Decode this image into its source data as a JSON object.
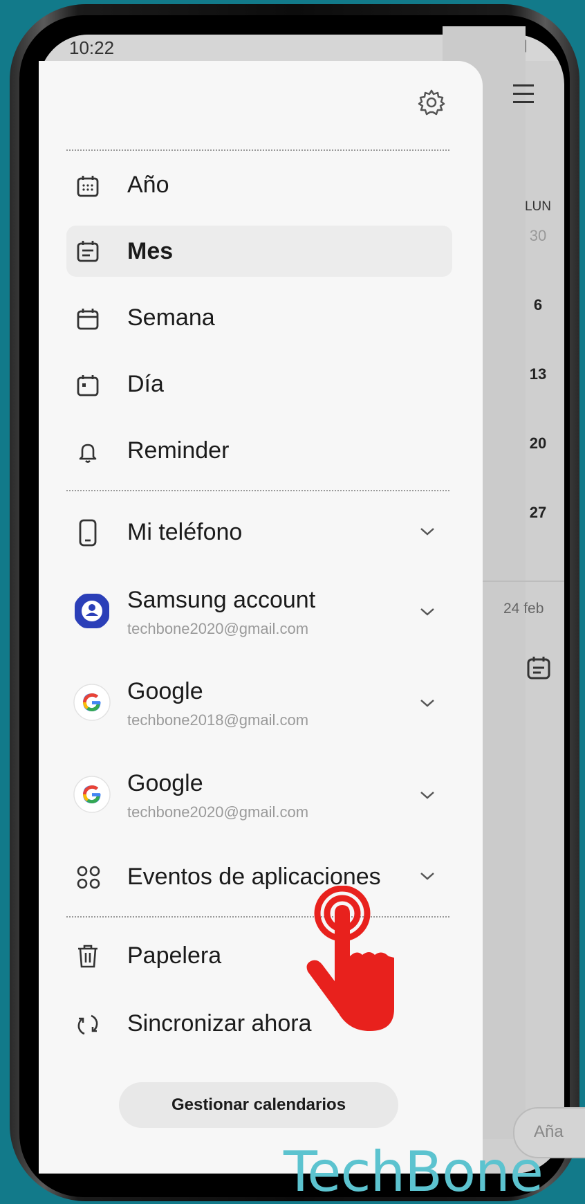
{
  "status_bar": {
    "time": "10:22",
    "icons": [
      "wifi-icon",
      "signal-icon",
      "signal-icon",
      "battery-icon"
    ]
  },
  "background_calendar": {
    "weekday": "LUN",
    "days": [
      "30",
      "6",
      "13",
      "20",
      "27"
    ],
    "date_label": "24 feb",
    "pill_label": "Aña"
  },
  "drawer": {
    "views": [
      {
        "label": "Año",
        "icon": "calendar-year-icon"
      },
      {
        "label": "Mes",
        "icon": "calendar-month-icon",
        "selected": true
      },
      {
        "label": "Semana",
        "icon": "calendar-week-icon"
      },
      {
        "label": "Día",
        "icon": "calendar-day-icon"
      },
      {
        "label": "Reminder",
        "icon": "bell-icon"
      }
    ],
    "accounts": [
      {
        "label": "Mi teléfono",
        "email": "",
        "icon": "phone-icon"
      },
      {
        "label": "Samsung account",
        "email": "techbone2020@gmail.com",
        "icon": "samsung-account-icon"
      },
      {
        "label": "Google",
        "email": "techbone2018@gmail.com",
        "icon": "google-icon"
      },
      {
        "label": "Google",
        "email": "techbone2020@gmail.com",
        "icon": "google-icon"
      },
      {
        "label": "Eventos de aplicaciones",
        "email": "",
        "icon": "apps-icon"
      }
    ],
    "actions": [
      {
        "label": "Papelera",
        "icon": "trash-icon"
      },
      {
        "label": "Sincronizar ahora",
        "icon": "sync-icon"
      }
    ],
    "manage_button": "Gestionar calendarios"
  },
  "watermark": "TechBone",
  "colors": {
    "background": "#127a8a",
    "drawer": "#f7f7f7",
    "tap_hand": "#e8211d",
    "watermark": "#5cc3cf"
  }
}
